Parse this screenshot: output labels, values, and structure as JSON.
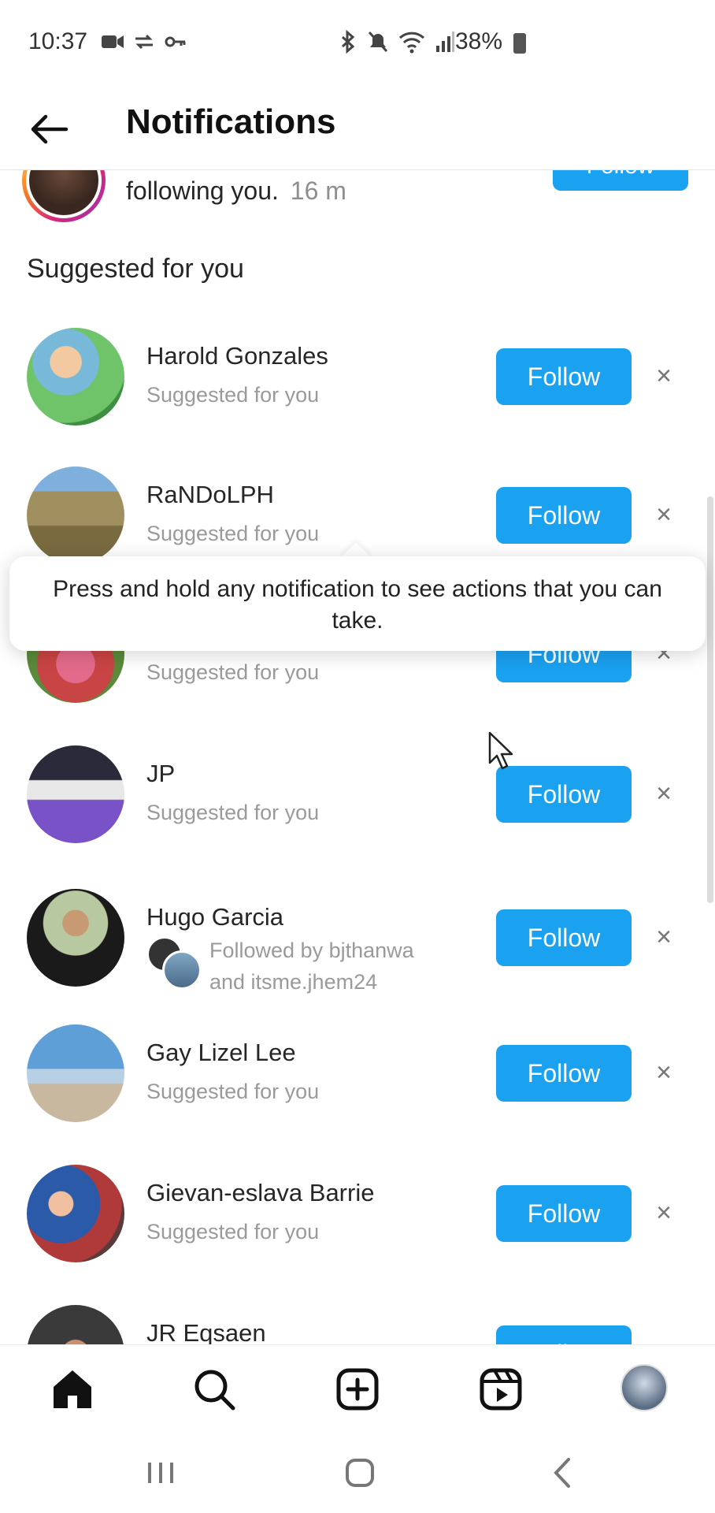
{
  "status_bar": {
    "time": "10:37",
    "battery": "38%"
  },
  "header": {
    "title": "Notifications"
  },
  "partial_notification": {
    "text": "following you.",
    "time": "16 m",
    "follow_label": "Follow"
  },
  "suggested": {
    "title": "Suggested for you",
    "items": [
      {
        "name": "Harold Gonzales",
        "sub": "Suggested for you",
        "follow_label": "Follow"
      },
      {
        "name": "RaNDoLPH",
        "sub": "Suggested for you",
        "follow_label": "Follow"
      },
      {
        "name": "",
        "sub": "Suggested for you",
        "follow_label": "Follow"
      },
      {
        "name": "JP",
        "sub": "Suggested for you",
        "follow_label": "Follow"
      },
      {
        "name": "Hugo Garcia",
        "sub_line1": "Followed by bjthanwa",
        "sub_line2": "and itsme.jhem24",
        "follow_label": "Follow"
      },
      {
        "name": "Gay Lizel Lee",
        "sub": "Suggested for you",
        "follow_label": "Follow"
      },
      {
        "name": "Gievan-eslava Barrie",
        "sub": "Suggested for you",
        "follow_label": "Follow"
      },
      {
        "name": "JR Eqsaen",
        "follow_label": "Follow"
      }
    ],
    "dismiss_symbol": "×"
  },
  "tooltip": {
    "text": "Press and hold any notification to see actions that you can take."
  },
  "bottom_nav": {
    "items": [
      "home-icon",
      "search-icon",
      "create-icon",
      "reels-icon",
      "profile-avatar"
    ]
  },
  "system_nav": {
    "items": [
      "recents-icon",
      "home-button-icon",
      "back-icon"
    ]
  },
  "colors": {
    "accent": "#1aa1f0",
    "secondary_text": "#9a9a9a"
  }
}
